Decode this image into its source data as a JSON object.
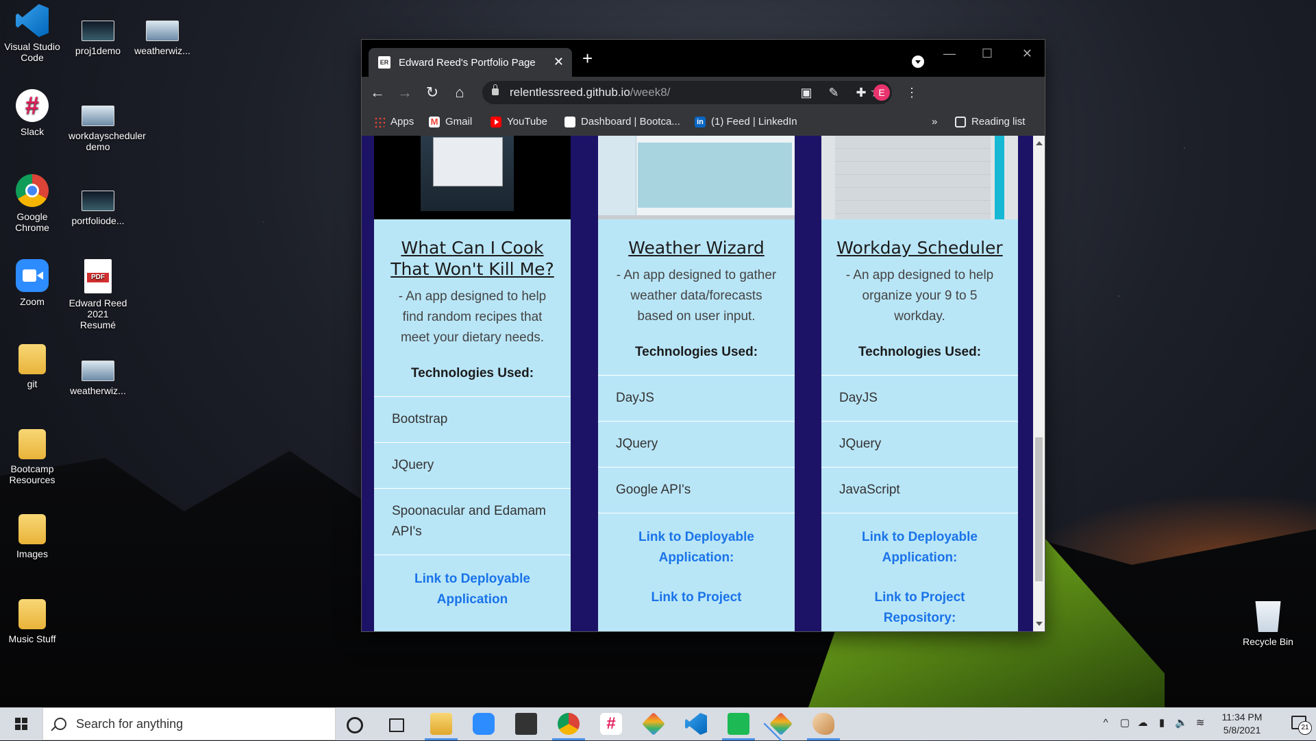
{
  "desktop": {
    "icons_col1": [
      {
        "label": "Visual Studio Code",
        "icon": "vscode-icon"
      },
      {
        "label": "Slack",
        "icon": "slack-icon"
      },
      {
        "label": "Google Chrome",
        "icon": "chrome-icon"
      },
      {
        "label": "Zoom",
        "icon": "zoom-icon"
      },
      {
        "label": "git",
        "icon": "folder-icon"
      },
      {
        "label": "Bootcamp Resources",
        "icon": "folder-icon"
      },
      {
        "label": "Images",
        "icon": "folder-icon"
      },
      {
        "label": "Music Stuff",
        "icon": "folder-icon"
      }
    ],
    "icons_col2": [
      {
        "label": "proj1demo",
        "icon": "video-thumbnail-icon"
      },
      {
        "label": "workdayscheduler demo",
        "icon": "video-thumbnail-icon"
      },
      {
        "label": "portfoliode...",
        "icon": "video-thumbnail-icon"
      },
      {
        "label": "Edward Reed 2021 Resumé",
        "icon": "pdf-icon"
      },
      {
        "label": "weatherwiz...",
        "icon": "video-thumbnail-icon"
      }
    ],
    "icons_col3": [
      {
        "label": "weatherwiz...",
        "icon": "video-thumbnail-icon"
      }
    ],
    "recycle_bin": "Recycle Bin"
  },
  "browser": {
    "tab": {
      "favicon": "ER",
      "title": "Edward Reed's Portfolio Page"
    },
    "url_host": "relentlessreed.github.io",
    "url_path": "/week8/",
    "avatar_letter": "E",
    "bookmarks": [
      {
        "label": "Apps",
        "icon": "apps-icon"
      },
      {
        "label": "Gmail",
        "icon": "gmail-icon"
      },
      {
        "label": "YouTube",
        "icon": "youtube-icon"
      },
      {
        "label": "Dashboard | Bootca...",
        "icon": "globe-icon"
      },
      {
        "label": "(1) Feed | LinkedIn",
        "icon": "linkedin-icon"
      }
    ],
    "bookmarks_overflow": "»",
    "reading_list": "Reading list"
  },
  "page": {
    "projects": [
      {
        "title": "What Can I Cook That Won't Kill Me?",
        "description": "- An app designed to help find random recipes that meet your dietary needs.",
        "tech_heading": "Technologies Used:",
        "technologies": [
          "Bootstrap",
          "JQuery",
          "Spoonacular and Edamam API's"
        ],
        "links": [
          "Link to Deployable Application"
        ]
      },
      {
        "title": "Weather Wizard",
        "description": "- An app designed to gather weather data/forecasts based on user input.",
        "tech_heading": "Technologies Used:",
        "technologies": [
          "DayJS",
          "JQuery",
          "Google API's"
        ],
        "links": [
          "Link to Deployable Application:",
          "Link to Project"
        ]
      },
      {
        "title": "Workday Scheduler",
        "description": "- An app designed to help organize your 9 to 5 workday.",
        "tech_heading": "Technologies Used:",
        "technologies": [
          "DayJS",
          "JQuery",
          "JavaScript"
        ],
        "links": [
          "Link to Deployable Application:",
          "Link to Project Repository:"
        ]
      }
    ]
  },
  "taskbar": {
    "search_placeholder": "Search for anything",
    "time": "11:34 PM",
    "date": "5/8/2021",
    "notifications_count": "21",
    "pinned": [
      "cortana-icon",
      "task-view-icon",
      "file-explorer-icon",
      "zoom-icon",
      "store-icon",
      "chrome-icon",
      "slack-icon",
      "git-kraken-icon",
      "vscode-icon",
      "spotify-icon",
      "git-kraken-icon",
      "paint-icon"
    ]
  }
}
